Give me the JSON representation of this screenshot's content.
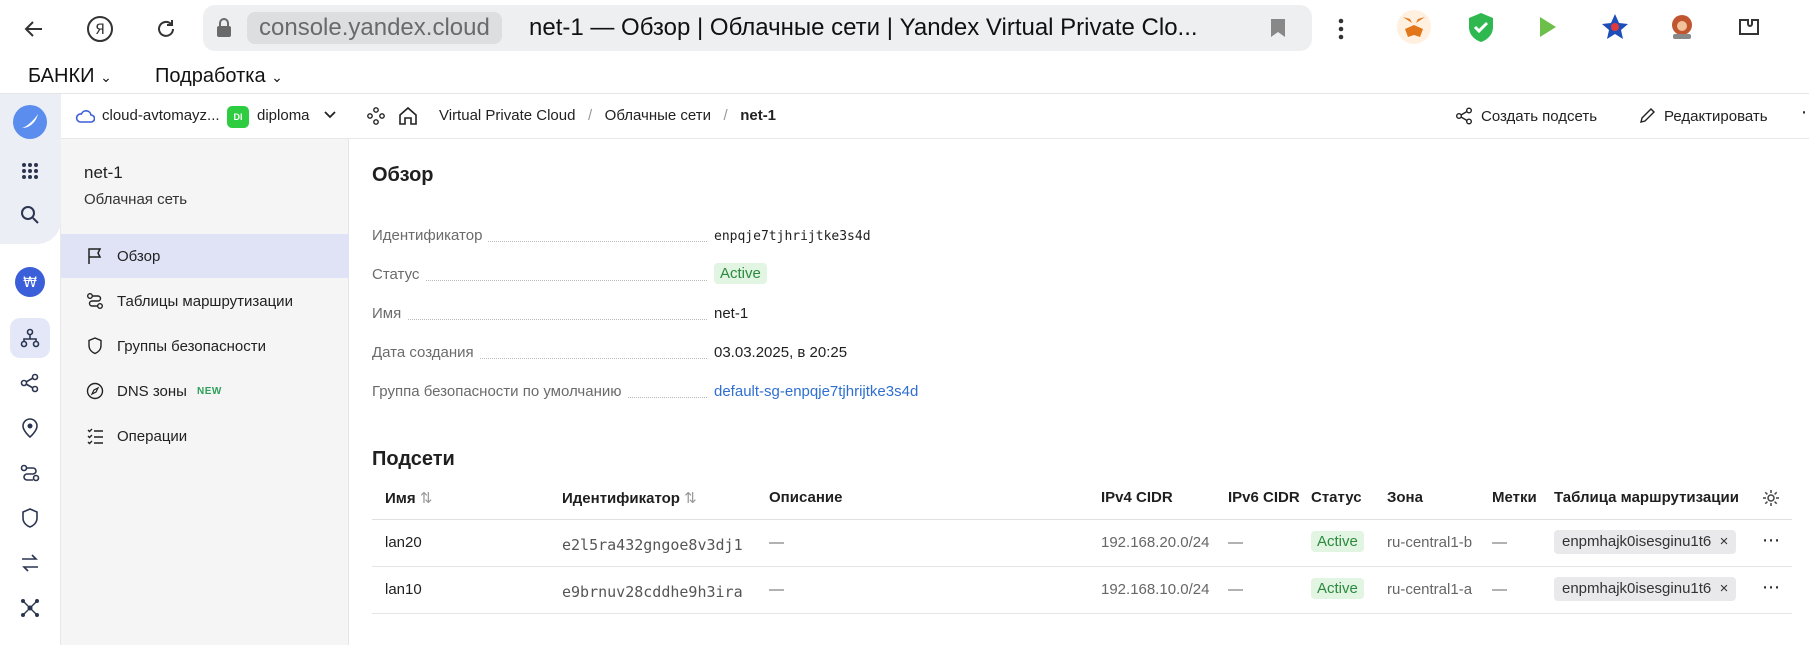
{
  "browser": {
    "url_host": "console.yandex.cloud",
    "tab_title": "net-1 — Обзор | Облачные сети | Yandex Virtual Private Clo..."
  },
  "bookmarks": [
    "БАНКИ",
    "Подработка"
  ],
  "header": {
    "cloud": "cloud-avtomayz...",
    "folder_badge": "DI",
    "folder": "diploma",
    "breadcrumb": [
      "Virtual Private Cloud",
      "Облачные сети",
      "net-1"
    ],
    "create_subnet": "Создать подсеть",
    "edit": "Редактировать"
  },
  "side": {
    "title": "net-1",
    "subtitle": "Облачная сеть",
    "items": [
      {
        "label": "Обзор"
      },
      {
        "label": "Таблицы маршрутизации"
      },
      {
        "label": "Группы безопасности"
      },
      {
        "label": "DNS зоны",
        "badge": "NEW"
      },
      {
        "label": "Операции"
      }
    ]
  },
  "overview": {
    "title": "Обзор",
    "fields": [
      {
        "label": "Идентификатор",
        "value": "enpqje7tjhrijtke3s4d"
      },
      {
        "label": "Статус",
        "value": "Active"
      },
      {
        "label": "Имя",
        "value": "net-1"
      },
      {
        "label": "Дата создания",
        "value": "03.03.2025, в 20:25"
      },
      {
        "label": "Группа безопасности по умолчанию",
        "value": "default-sg-enpqje7tjhrijtke3s4d"
      }
    ]
  },
  "subnets": {
    "title": "Подсети",
    "columns": [
      "Имя",
      "Идентификатор",
      "Описание",
      "IPv4 CIDR",
      "IPv6 CIDR",
      "Статус",
      "Зона",
      "Метки",
      "Таблица маршрутизации"
    ],
    "rows": [
      {
        "name": "lan20",
        "id": "e2l5ra432gngoe8v3dj1",
        "desc": "—",
        "ipv4": "192.168.20.0/24",
        "ipv6": "—",
        "status": "Active",
        "zone": "ru-central1-b",
        "labels": "—",
        "route": "enpmhajk0isesginu1t6"
      },
      {
        "name": "lan10",
        "id": "e9brnuv28cddhe9h3ira",
        "desc": "—",
        "ipv4": "192.168.10.0/24",
        "ipv6": "—",
        "status": "Active",
        "zone": "ru-central1-a",
        "labels": "—",
        "route": "enpmhajk0isesginu1t6"
      }
    ]
  },
  "colors": {
    "accent": "#2f6fd1",
    "active_bg": "#e2f4e2",
    "active_fg": "#2b8a3e",
    "menu_active": "#dfe3f5"
  }
}
